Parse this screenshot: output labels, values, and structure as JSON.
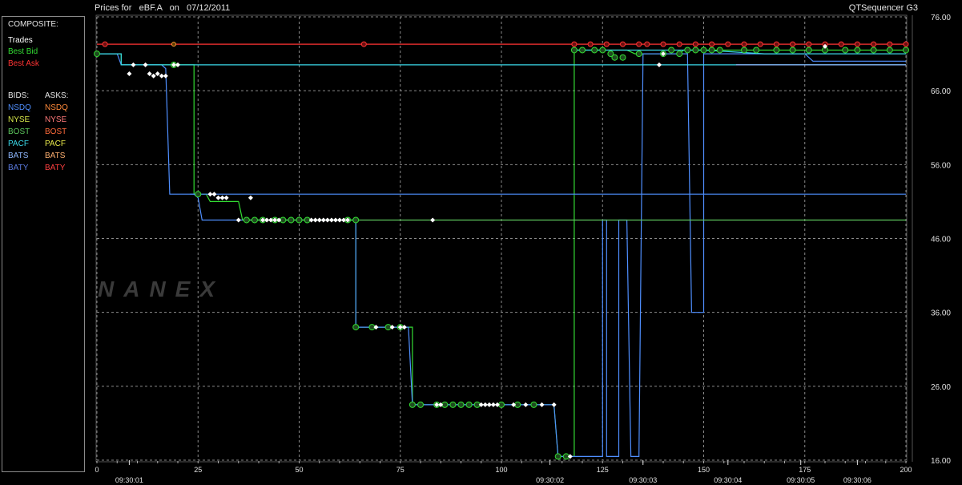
{
  "header": {
    "prefix": "Prices for",
    "symbol": "eBF.A",
    "on_label": "on",
    "date": "07/12/2011",
    "app_name": "QTSequencer G3"
  },
  "legend": {
    "composite_label": "COMPOSITE:",
    "composite": [
      {
        "label": "Trades",
        "color": "#ffffff"
      },
      {
        "label": "Best Bid",
        "color": "#33dd33"
      },
      {
        "label": "Best Ask",
        "color": "#ff3333"
      }
    ],
    "bids_label": "BIDS:",
    "asks_label": "ASKS:",
    "exchanges": [
      {
        "bid": "NSDQ",
        "bid_color": "#4f8fff",
        "ask": "NSDQ",
        "ask_color": "#ff8a3a"
      },
      {
        "bid": "NYSE",
        "bid_color": "#d8e84a",
        "ask": "NYSE",
        "ask_color": "#ff7a7a"
      },
      {
        "bid": "BOST",
        "bid_color": "#5cc65c",
        "ask": "BOST",
        "ask_color": "#ff6a3a"
      },
      {
        "bid": "PACF",
        "bid_color": "#3ad8e8",
        "ask": "PACF",
        "ask_color": "#e8e84a"
      },
      {
        "bid": "BATS",
        "bid_color": "#8fb8ff",
        "ask": "BATS",
        "ask_color": "#ffb070"
      },
      {
        "bid": "BATY",
        "bid_color": "#5a7adf",
        "ask": "BATY",
        "ask_color": "#ff4040"
      }
    ]
  },
  "watermark": "NANEX",
  "chart_data": {
    "type": "line",
    "xlim": [
      0,
      200
    ],
    "ylim": [
      16,
      76
    ],
    "x_ticks": [
      0,
      25,
      50,
      75,
      100,
      125,
      150,
      175,
      200
    ],
    "y_ticks": [
      16,
      26,
      36,
      46,
      56,
      66,
      76
    ],
    "y_tick_labels": [
      "16.00",
      "26.00",
      "36.00",
      "46.00",
      "56.00",
      "66.00",
      "76.00"
    ],
    "time_ticks": [
      {
        "x": 8,
        "label": "09:30:01"
      },
      {
        "x": 112,
        "label": "09:30:02"
      },
      {
        "x": 135,
        "label": "09:30:03"
      },
      {
        "x": 156,
        "label": "09:30:04"
      },
      {
        "x": 174,
        "label": "09:30:05"
      },
      {
        "x": 188,
        "label": "09:30:06"
      }
    ],
    "grid": true,
    "series": [
      {
        "name": "Best Ask",
        "color": "#ff3333",
        "points": [
          [
            0,
            72.3
          ],
          [
            10,
            72.3
          ],
          [
            40,
            72.3
          ],
          [
            66,
            72.3
          ],
          [
            120,
            72.3
          ],
          [
            200,
            72.3
          ]
        ]
      },
      {
        "name": "Best Bid",
        "color": "#33dd33",
        "points": [
          [
            0,
            71
          ],
          [
            6,
            71
          ],
          [
            6,
            69.5
          ],
          [
            19,
            69.5
          ],
          [
            19,
            69.5
          ],
          [
            23,
            69.5
          ],
          [
            23,
            69.5
          ],
          [
            24,
            69.5
          ],
          [
            24,
            52
          ],
          [
            27,
            52
          ],
          [
            28,
            51
          ],
          [
            35,
            51
          ],
          [
            36,
            48.5
          ],
          [
            62,
            48.5
          ],
          [
            64,
            48.5
          ],
          [
            64,
            34
          ],
          [
            76,
            34
          ],
          [
            78,
            34
          ],
          [
            78,
            23.5
          ],
          [
            113,
            23.5
          ],
          [
            113,
            23.5
          ],
          [
            114,
            16.5
          ],
          [
            118,
            16.5
          ],
          [
            118,
            71.5
          ],
          [
            131,
            71.5
          ],
          [
            133,
            71
          ],
          [
            144,
            71
          ],
          [
            145,
            71.5
          ],
          [
            200,
            71.5
          ]
        ]
      },
      {
        "name": "NSDQ",
        "color": "#4f8fff",
        "points": [
          [
            0,
            71
          ],
          [
            5,
            71
          ],
          [
            6,
            69.5
          ],
          [
            16,
            69.5
          ],
          [
            17,
            69
          ],
          [
            17,
            69
          ],
          [
            18,
            52
          ],
          [
            24,
            52
          ],
          [
            25,
            51.5
          ],
          [
            26,
            48.5
          ],
          [
            62,
            48.5
          ],
          [
            64,
            48.5
          ],
          [
            64,
            34
          ],
          [
            76,
            34
          ],
          [
            77,
            34
          ],
          [
            78,
            23.5
          ],
          [
            113,
            23.5
          ],
          [
            114,
            16.5
          ],
          [
            125,
            16.5
          ],
          [
            125,
            48.5
          ],
          [
            126,
            48.5
          ],
          [
            126,
            16.5
          ],
          [
            129,
            16.5
          ],
          [
            129,
            48.5
          ],
          [
            131,
            48.5
          ],
          [
            132,
            16.5
          ],
          [
            134,
            16.5
          ],
          [
            135,
            71
          ],
          [
            146,
            71
          ],
          [
            147,
            36
          ],
          [
            150,
            36
          ],
          [
            150,
            69
          ],
          [
            150,
            71
          ],
          [
            175,
            71
          ],
          [
            177,
            70
          ],
          [
            200,
            70
          ]
        ]
      },
      {
        "name": "NSDQ (2)",
        "color": "#4f8fff",
        "points": [
          [
            23,
            52
          ],
          [
            200,
            52
          ]
        ]
      },
      {
        "name": "PACF",
        "color": "#3ad8e8",
        "points": [
          [
            0,
            71
          ],
          [
            6,
            71
          ],
          [
            6,
            69.5
          ],
          [
            200,
            69.5
          ]
        ]
      },
      {
        "name": "BOST",
        "color": "#5cc65c",
        "points": [
          [
            36,
            48.5
          ],
          [
            200,
            48.5
          ]
        ]
      },
      {
        "name": "PACF (2)",
        "color": "#3ad8e8",
        "points": [
          [
            118,
            71.5
          ],
          [
            150,
            71.5
          ],
          [
            165,
            71
          ],
          [
            200,
            71
          ]
        ]
      },
      {
        "name": "BATS",
        "color": "#8fb8ff",
        "points": [
          [
            158,
            69.5
          ],
          [
            200,
            69.5
          ]
        ]
      }
    ],
    "trades": [
      [
        8,
        68.3
      ],
      [
        9,
        69.5
      ],
      [
        12,
        69.5
      ],
      [
        13,
        68.3
      ],
      [
        14,
        68
      ],
      [
        15,
        68.3
      ],
      [
        16,
        68
      ],
      [
        17,
        68
      ],
      [
        19,
        69.5
      ],
      [
        20,
        69.5
      ],
      [
        28,
        52
      ],
      [
        29,
        52
      ],
      [
        30,
        51.5
      ],
      [
        31,
        51.5
      ],
      [
        32,
        51.5
      ],
      [
        35,
        48.5
      ],
      [
        38,
        51.5
      ],
      [
        41,
        48.5
      ],
      [
        42,
        48.5
      ],
      [
        43,
        48.5
      ],
      [
        44,
        48.5
      ],
      [
        45,
        48.5
      ],
      [
        53,
        48.5
      ],
      [
        54,
        48.5
      ],
      [
        55,
        48.5
      ],
      [
        56,
        48.5
      ],
      [
        57,
        48.5
      ],
      [
        58,
        48.5
      ],
      [
        59,
        48.5
      ],
      [
        60,
        48.5
      ],
      [
        61,
        48.5
      ],
      [
        62,
        48.5
      ],
      [
        83,
        48.5
      ],
      [
        69,
        34
      ],
      [
        73,
        34
      ],
      [
        75,
        34
      ],
      [
        76,
        34
      ],
      [
        84,
        23.5
      ],
      [
        85,
        23.5
      ],
      [
        95,
        23.5
      ],
      [
        96,
        23.5
      ],
      [
        97,
        23.5
      ],
      [
        98,
        23.5
      ],
      [
        99,
        23.5
      ],
      [
        103,
        23.5
      ],
      [
        106,
        23.5
      ],
      [
        110,
        23.5
      ],
      [
        113,
        23.5
      ],
      [
        117,
        16.5
      ],
      [
        139,
        69.5
      ],
      [
        140,
        71
      ],
      [
        180,
        72
      ]
    ],
    "bid_markers": [
      [
        0,
        71
      ],
      [
        19,
        69.5
      ],
      [
        25,
        52
      ],
      [
        37,
        48.5
      ],
      [
        39,
        48.5
      ],
      [
        41,
        48.5
      ],
      [
        44,
        48.5
      ],
      [
        46,
        48.5
      ],
      [
        48,
        48.5
      ],
      [
        50,
        48.5
      ],
      [
        52,
        48.5
      ],
      [
        62,
        48.5
      ],
      [
        64,
        48.5
      ],
      [
        64,
        34
      ],
      [
        68,
        34
      ],
      [
        72,
        34
      ],
      [
        75,
        34
      ],
      [
        78,
        23.5
      ],
      [
        80,
        23.5
      ],
      [
        84,
        23.5
      ],
      [
        86,
        23.5
      ],
      [
        88,
        23.5
      ],
      [
        90,
        23.5
      ],
      [
        92,
        23.5
      ],
      [
        94,
        23.5
      ],
      [
        100,
        23.5
      ],
      [
        104,
        23.5
      ],
      [
        108,
        23.5
      ],
      [
        114,
        16.5
      ],
      [
        116,
        16.5
      ],
      [
        118,
        71.5
      ],
      [
        120,
        71.5
      ],
      [
        123,
        71.5
      ],
      [
        125,
        71.5
      ],
      [
        127,
        71
      ],
      [
        128,
        70.5
      ],
      [
        130,
        70.5
      ],
      [
        134,
        71
      ],
      [
        140,
        71
      ],
      [
        142,
        71.5
      ],
      [
        144,
        71
      ],
      [
        146,
        71.5
      ],
      [
        148,
        71.5
      ],
      [
        150,
        71.5
      ],
      [
        152,
        71.5
      ],
      [
        154,
        71.5
      ],
      [
        160,
        71.5
      ],
      [
        163,
        71.5
      ],
      [
        168,
        71.5
      ],
      [
        172,
        71.5
      ],
      [
        176,
        71.5
      ],
      [
        180,
        71.5
      ],
      [
        185,
        71.5
      ],
      [
        188,
        71.5
      ],
      [
        192,
        71.5
      ],
      [
        196,
        71.5
      ],
      [
        200,
        71.5
      ]
    ],
    "ask_markers": [
      [
        2,
        72.3
      ],
      [
        66,
        72.3
      ],
      [
        118,
        72.3
      ],
      [
        122,
        72.3
      ],
      [
        126,
        72.3
      ],
      [
        130,
        72.3
      ],
      [
        134,
        72.3
      ],
      [
        136,
        72.3
      ],
      [
        140,
        72.3
      ],
      [
        144,
        72.3
      ],
      [
        148,
        72.3
      ],
      [
        152,
        72.3
      ],
      [
        156,
        72.3
      ],
      [
        160,
        72.3
      ],
      [
        164,
        72.3
      ],
      [
        168,
        72.3
      ],
      [
        172,
        72.3
      ],
      [
        176,
        72.3
      ],
      [
        180,
        72.3
      ],
      [
        184,
        72.3
      ],
      [
        188,
        72.3
      ],
      [
        192,
        72.3
      ],
      [
        196,
        72.3
      ],
      [
        200,
        72.3
      ]
    ],
    "ask_marker_special": [
      [
        19,
        72.3
      ]
    ]
  }
}
